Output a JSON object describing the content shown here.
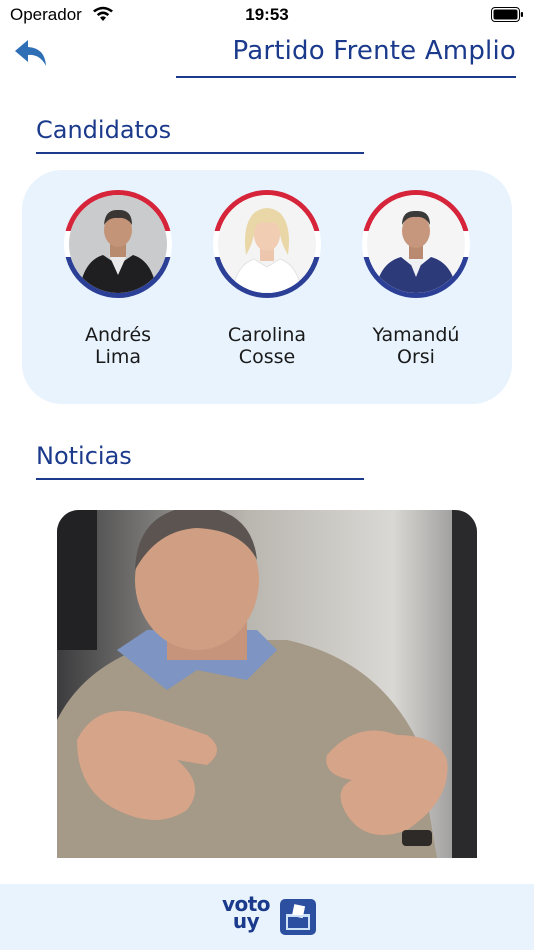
{
  "status_bar": {
    "carrier": "Operador",
    "time": "19:53"
  },
  "header": {
    "title": "Partido Frente Amplio"
  },
  "candidates_section": {
    "heading": "Candidatos",
    "candidates": [
      {
        "name": "Andrés\nLima",
        "first": "Andrés",
        "last": "Lima"
      },
      {
        "name": "Carolina\nCosse",
        "first": "Carolina",
        "last": "Cosse"
      },
      {
        "name": "Yamandú\nOrsi",
        "first": "Yamandú",
        "last": "Orsi"
      }
    ]
  },
  "news_section": {
    "heading": "Noticias"
  },
  "footer": {
    "logo_line1": "voto",
    "logo_line2": "uy"
  },
  "colors": {
    "accent": "#1b3a8c",
    "card_bg": "#e8f3fd",
    "ring_red": "#d6243a",
    "ring_blue": "#2c3f96"
  }
}
